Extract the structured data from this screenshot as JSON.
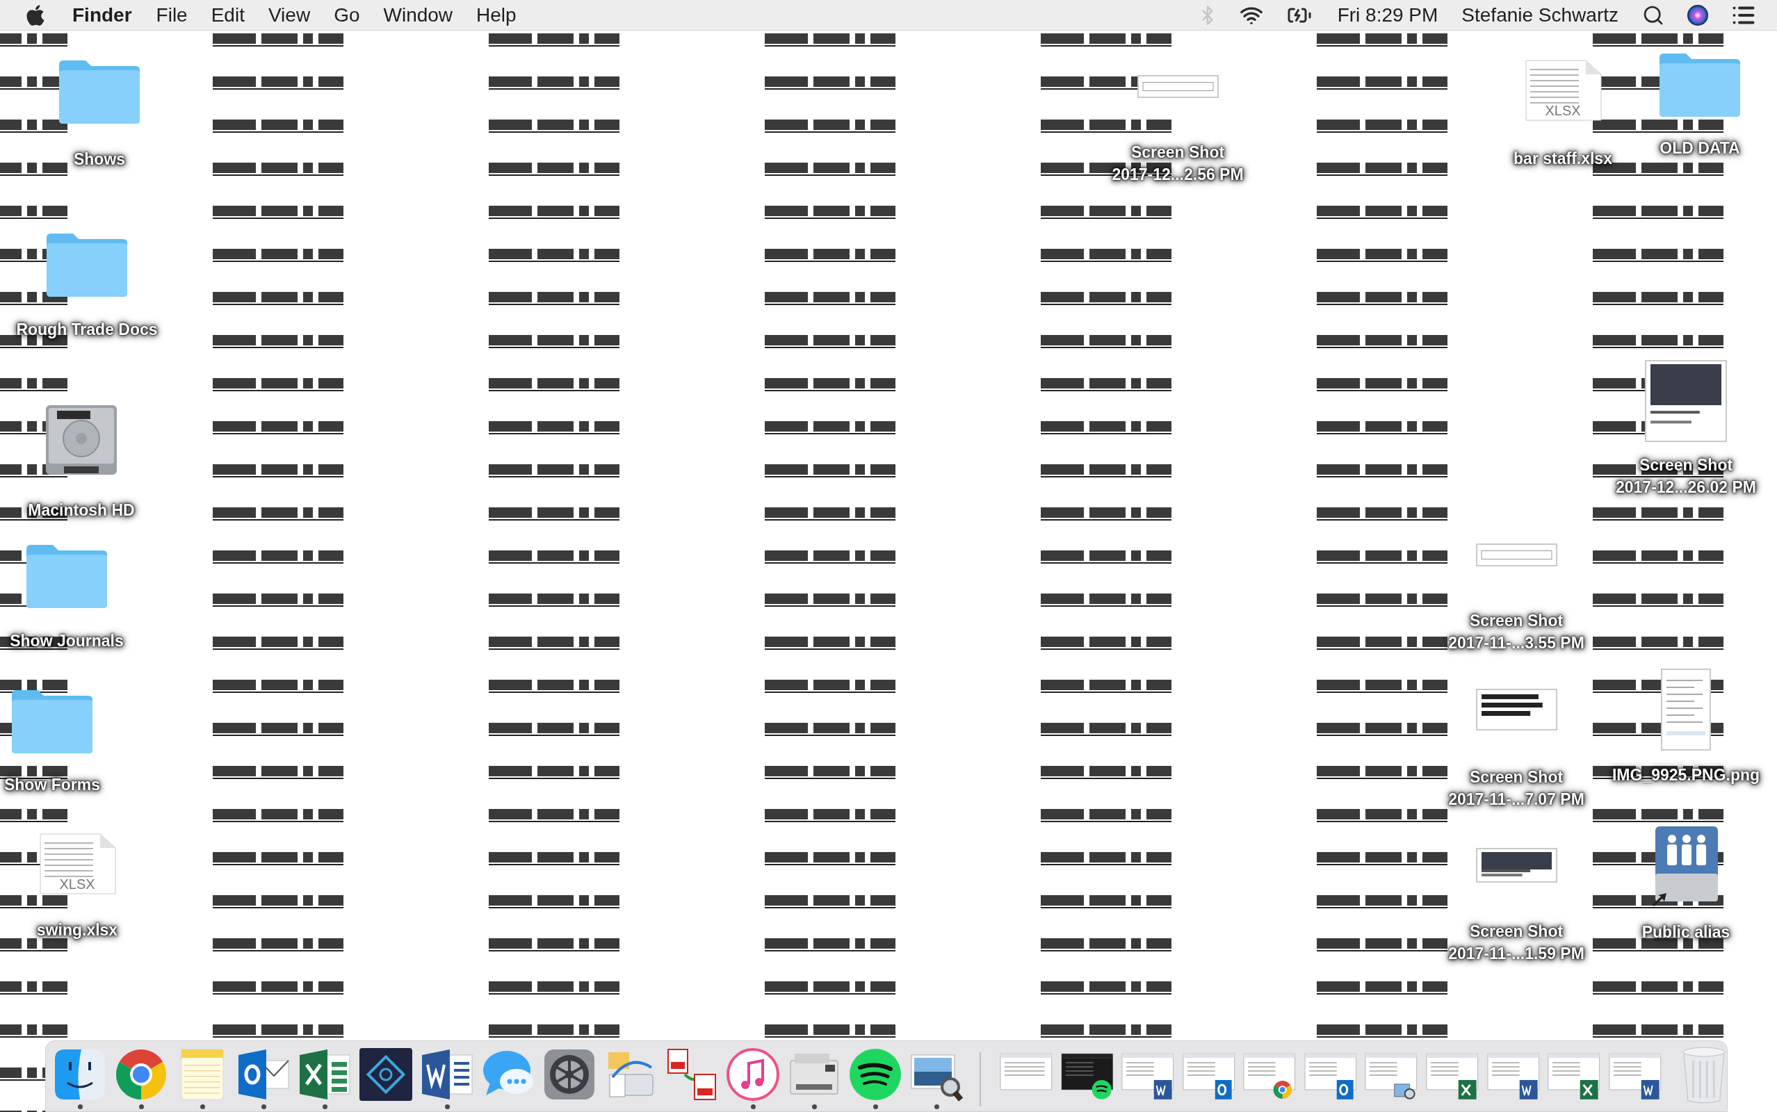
{
  "menu_bar": {
    "menus": [
      {
        "label": "Finder",
        "kind": "app"
      },
      {
        "label": "File",
        "kind": "menu"
      },
      {
        "label": "Edit",
        "kind": "menu"
      },
      {
        "label": "View",
        "kind": "menu"
      },
      {
        "label": "Go",
        "kind": "menu"
      },
      {
        "label": "Window",
        "kind": "menu"
      },
      {
        "label": "Help",
        "kind": "menu"
      }
    ],
    "bluetooth_on": false,
    "clock": "Fri 8:29 PM",
    "user": "Stefanie Schwartz"
  },
  "desktop": {
    "icons": [
      {
        "label": "Shows",
        "kind": "folder"
      },
      {
        "label": "Screen Shot 2017-12...2.56 PM",
        "kind": "screenshot"
      },
      {
        "label": "bar staff.xlsx",
        "kind": "spreadsheet",
        "badge": "XLSX"
      },
      {
        "label": "OLD DATA",
        "kind": "folder"
      },
      {
        "label": "Rough Trade Docs",
        "kind": "folder"
      },
      {
        "label": "Screen Shot 2017-12...26.02 PM",
        "kind": "screenshot"
      },
      {
        "label": "Macintosh HD",
        "kind": "disk"
      },
      {
        "label": "Show Journals",
        "kind": "folder"
      },
      {
        "label": "Screen Shot 2017-11-...3.55 PM",
        "kind": "screenshot"
      },
      {
        "label": "Show Forms",
        "kind": "folder"
      },
      {
        "label": "Screen Shot 2017-11-...7.07 PM",
        "kind": "screenshot"
      },
      {
        "label": "IMG_9925.PNG.png",
        "kind": "phone_screenshot"
      },
      {
        "label": "swing.xlsx",
        "kind": "spreadsheet",
        "badge": "XLSX"
      },
      {
        "label": "Screen Shot 2017-11-...1.59 PM",
        "kind": "screenshot"
      },
      {
        "label": "Public alias",
        "kind": "shared_drive"
      }
    ]
  },
  "dock": {
    "apps": [
      {
        "kind": "finder",
        "running": true
      },
      {
        "kind": "chrome",
        "running": true
      },
      {
        "kind": "notes",
        "running": true
      },
      {
        "kind": "outlook",
        "running": true
      },
      {
        "kind": "excel",
        "running": true
      },
      {
        "kind": "aperture",
        "running": false
      },
      {
        "kind": "word",
        "running": true
      },
      {
        "kind": "messages",
        "running": false
      },
      {
        "kind": "preferences",
        "running": false
      },
      {
        "kind": "fax",
        "running": false
      },
      {
        "kind": "pdf",
        "running": false
      },
      {
        "kind": "music",
        "running": true
      },
      {
        "kind": "printer",
        "running": true
      },
      {
        "kind": "spotify",
        "running": true
      },
      {
        "kind": "preview",
        "running": true
      }
    ],
    "minimized": [
      {
        "kind": "plain"
      },
      {
        "kind": "spotify"
      },
      {
        "kind": "word"
      },
      {
        "kind": "outlook"
      },
      {
        "kind": "chrome"
      },
      {
        "kind": "outlook"
      },
      {
        "kind": "preview"
      },
      {
        "kind": "excel"
      },
      {
        "kind": "word"
      },
      {
        "kind": "excel"
      },
      {
        "kind": "word"
      }
    ],
    "trash": {
      "kind": "empty"
    }
  }
}
